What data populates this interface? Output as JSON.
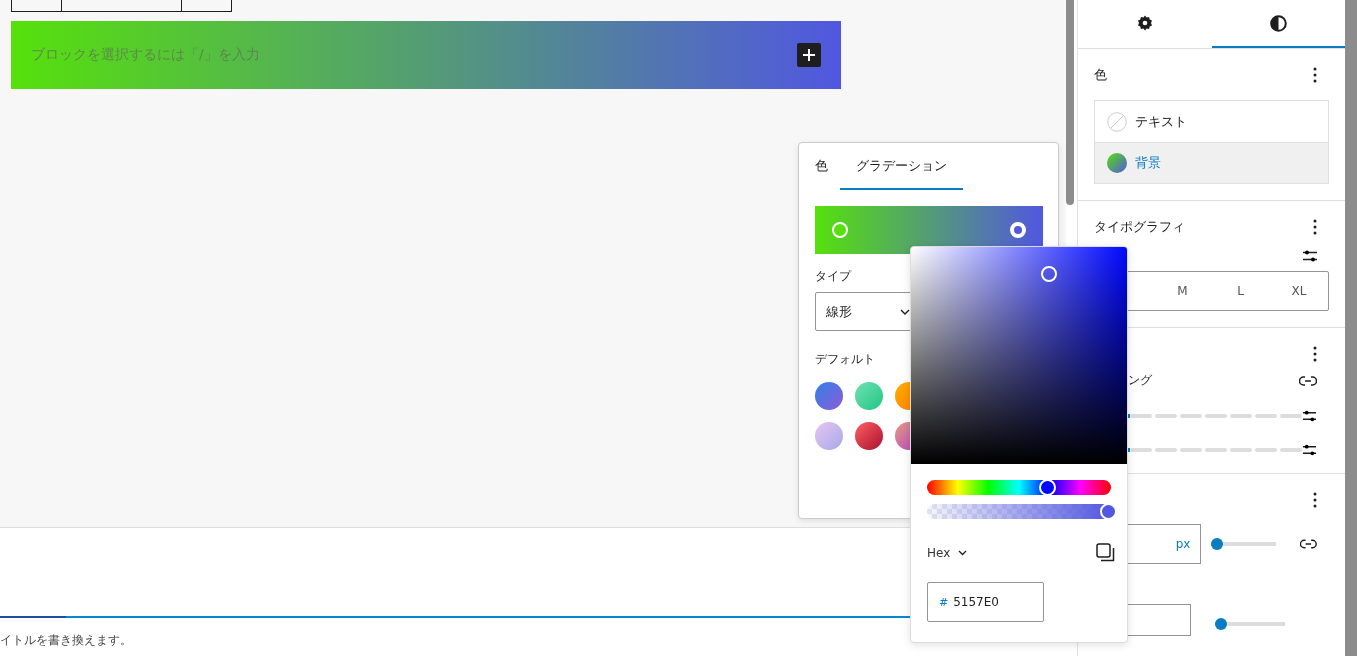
{
  "editor": {
    "block": {
      "placeholder": "ブロックを選択するには「/」を入力"
    },
    "footer_text": "イトルを書き換えます。"
  },
  "sidebar": {
    "tabs": [
      {
        "kind": "settings",
        "selected": false
      },
      {
        "kind": "styles",
        "selected": true
      }
    ],
    "color": {
      "title": "色",
      "items": [
        {
          "label": "テキスト",
          "kind": "none",
          "selected": false
        },
        {
          "label": "背景",
          "kind": "gradient",
          "selected": true
        }
      ]
    },
    "typography": {
      "title": "タイポグラフィ",
      "sizes": [
        {
          "label": "M",
          "selected": false
        },
        {
          "label": "L",
          "selected": false
        },
        {
          "label": "XL",
          "selected": false
        }
      ]
    },
    "dimensions": {
      "padding_label": "ング",
      "sliders": [
        {
          "level": 0
        },
        {
          "level": 0
        }
      ]
    },
    "border": {
      "unit": "px",
      "slider": {
        "level": 0
      },
      "radius_slider": {
        "level": 0
      }
    }
  },
  "gradient_popover": {
    "tabs": [
      {
        "label": "色",
        "selected": false
      },
      {
        "label": "グラデーション",
        "selected": true
      }
    ],
    "stops": [
      {
        "color": "#56e10b",
        "selected": false
      },
      {
        "color": "#5157e0",
        "selected": true
      }
    ],
    "type_label": "タイプ",
    "type_value": "線形",
    "defaults_label": "デフォルト"
  },
  "color_picker": {
    "hue": {
      "level": 0.65
    },
    "alpha": {
      "level": 1
    },
    "format": "Hex",
    "hash": "#",
    "value": "5157E0"
  }
}
